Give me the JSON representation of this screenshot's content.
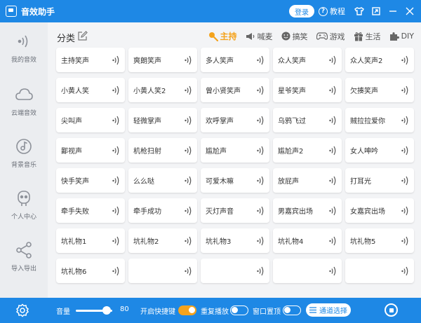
{
  "app": {
    "title": "音效助手",
    "login_label": "登录",
    "tutorial_label": "教程"
  },
  "sidebar": {
    "items": [
      {
        "label": "我的音效",
        "icon": "sound-wave-icon"
      },
      {
        "label": "云端音效",
        "icon": "cloud-icon"
      },
      {
        "label": "背景音乐",
        "icon": "music-disc-icon"
      },
      {
        "label": "个人中心",
        "icon": "user-icon"
      },
      {
        "label": "导入导出",
        "icon": "share-icon"
      }
    ]
  },
  "main": {
    "category_label": "分类",
    "tabs": [
      {
        "label": "主持",
        "icon": "mic-icon",
        "active": true
      },
      {
        "label": "喊麦",
        "icon": "megaphone-icon",
        "active": false
      },
      {
        "label": "搞笑",
        "icon": "smile-icon",
        "active": false
      },
      {
        "label": "游戏",
        "icon": "gamepad-icon",
        "active": false
      },
      {
        "label": "生活",
        "icon": "gift-icon",
        "active": false
      },
      {
        "label": "DIY",
        "icon": "puzzle-icon",
        "active": false
      }
    ],
    "cards": [
      "主持笑声",
      "爽朗笑声",
      "多人笑声",
      "众人笑声",
      "众人笑声2",
      "小黄人笑",
      "小黄人笑2",
      "曾小贤笑声",
      "星爷笑声",
      "欠揍笑声",
      "尖叫声",
      "轻微掌声",
      "欢呼掌声",
      "乌鸦飞过",
      "贼拉拉爱你",
      "鄙视声",
      "机枪扫射",
      "尴尬声",
      "尴尬声2",
      "女人呻吟",
      "快手笑声",
      "么么哒",
      "可爱木嘛",
      "放屁声",
      "打耳光",
      "牵手失败",
      "牵手成功",
      "灭灯声音",
      "男嘉宾出场",
      "女嘉宾出场",
      "坑礼物1",
      "坑礼物2",
      "坑礼物3",
      "坑礼物4",
      "坑礼物5",
      "坑礼物6",
      "",
      "",
      "",
      ""
    ]
  },
  "bottom": {
    "volume_label": "音量",
    "volume_value": "80",
    "volume_level": 0.8,
    "hotkey_label": "开启快捷键",
    "hotkey_on": true,
    "repeat_label": "重复播放",
    "repeat_on": false,
    "ontop_label": "窗口置顶",
    "ontop_on": false,
    "channel_label": "通道选择"
  },
  "colors": {
    "accent": "#1e88e5",
    "active_tab": "#f4a31d",
    "sidebar_bg": "#ebedf0",
    "main_bg": "#f3f4f6"
  }
}
